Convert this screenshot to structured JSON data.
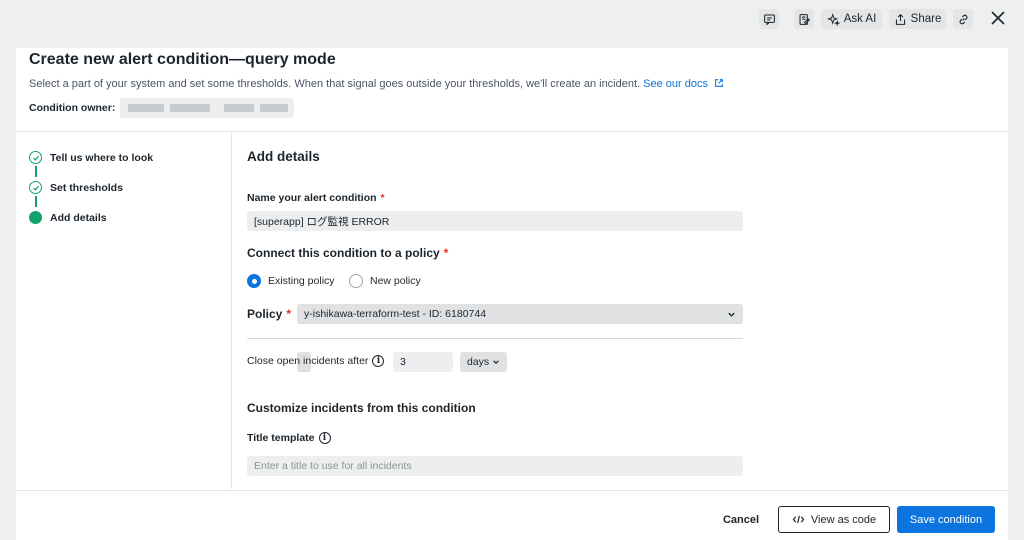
{
  "toolbar": {
    "ask_ai_label": "Ask AI",
    "share_label": "Share"
  },
  "header": {
    "title": "Create new alert condition—query mode",
    "subtitle": "Select a part of your system and set some thresholds. When that signal goes outside your thresholds, we'll create an incident.",
    "docs_link": "See our docs",
    "owner_label": "Condition owner:"
  },
  "steps": [
    {
      "label": "Tell us where to look",
      "status": "complete"
    },
    {
      "label": "Set thresholds",
      "status": "complete"
    },
    {
      "label": "Add details",
      "status": "active"
    }
  ],
  "form": {
    "section_title": "Add details",
    "name_label": "Name your alert condition",
    "name_value": "[superapp] ログ監視 ERROR",
    "policy_section": "Connect this condition to a policy",
    "radio_existing": "Existing policy",
    "radio_new": "New policy",
    "selected_radio": "existing",
    "policy_label": "Policy",
    "policy_value": "y-ishikawa-terraform-test - ID: 6180744",
    "close_label": "Close open incidents after",
    "close_value": "3",
    "close_unit": "days",
    "customize_title": "Customize incidents from this condition",
    "title_template_label": "Title template",
    "title_template_placeholder": "Enter a title to use for all incidents",
    "required_mark": "*"
  },
  "footer": {
    "cancel_label": "Cancel",
    "view_code_label": "View as code",
    "save_label": "Save condition"
  },
  "colors": {
    "primary": "#0c74df",
    "success": "#10a26a",
    "required": "#df2d24"
  }
}
